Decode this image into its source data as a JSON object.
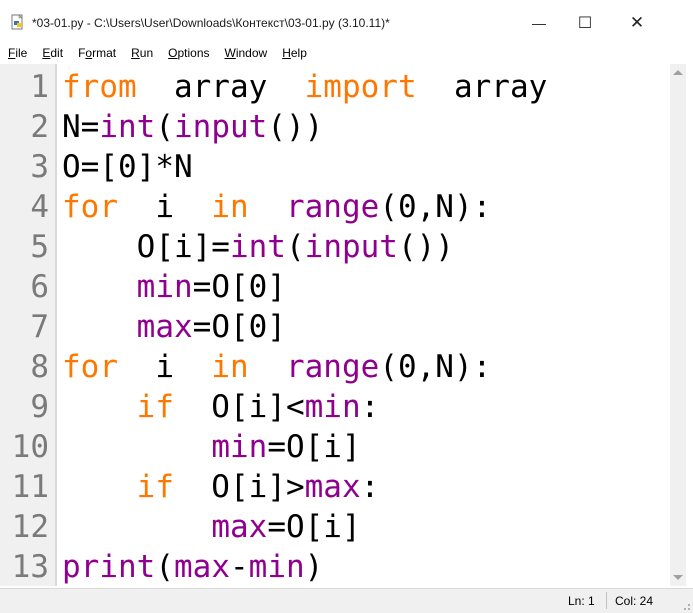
{
  "window": {
    "title": "*03-01.py - C:\\Users\\User\\Downloads\\Контекст\\03-01.py (3.10.11)*",
    "minimize_glyph": "—",
    "maximize_glyph": "☐",
    "close_glyph": "✕"
  },
  "menu": [
    {
      "pre": "",
      "ul": "F",
      "post": "ile"
    },
    {
      "pre": "",
      "ul": "E",
      "post": "dit"
    },
    {
      "pre": "F",
      "ul": "o",
      "post": "rmat"
    },
    {
      "pre": "",
      "ul": "R",
      "post": "un"
    },
    {
      "pre": "",
      "ul": "O",
      "post": "ptions"
    },
    {
      "pre": "",
      "ul": "W",
      "post": "indow"
    },
    {
      "pre": "",
      "ul": "H",
      "post": "elp"
    }
  ],
  "colors": {
    "keyword": "#ff7700",
    "builtin": "#900090",
    "text": "#000000",
    "line_number": "#7a7a7a"
  },
  "code": [
    {
      "n": "1",
      "t": [
        [
          "kw",
          "from"
        ],
        [
          "",
          "  array  "
        ],
        [
          "kw",
          "import"
        ],
        [
          "",
          "  array"
        ]
      ]
    },
    {
      "n": "2",
      "t": [
        [
          "",
          "N="
        ],
        [
          "bi",
          "int"
        ],
        [
          "",
          "("
        ],
        [
          "bi",
          "input"
        ],
        [
          "",
          "())"
        ]
      ]
    },
    {
      "n": "3",
      "t": [
        [
          "",
          "O=[0]*N"
        ]
      ]
    },
    {
      "n": "4",
      "t": [
        [
          "kw",
          "for"
        ],
        [
          "",
          "  i  "
        ],
        [
          "kw",
          "in"
        ],
        [
          "",
          "  "
        ],
        [
          "bi",
          "range"
        ],
        [
          "",
          "(0,N):"
        ]
      ]
    },
    {
      "n": "5",
      "t": [
        [
          "",
          "    O[i]="
        ],
        [
          "bi",
          "int"
        ],
        [
          "",
          "("
        ],
        [
          "bi",
          "input"
        ],
        [
          "",
          "())"
        ]
      ]
    },
    {
      "n": "6",
      "t": [
        [
          "",
          "    "
        ],
        [
          "bi",
          "min"
        ],
        [
          "",
          "=O[0]"
        ]
      ]
    },
    {
      "n": "7",
      "t": [
        [
          "",
          "    "
        ],
        [
          "bi",
          "max"
        ],
        [
          "",
          "=O[0]"
        ]
      ]
    },
    {
      "n": "8",
      "t": [
        [
          "kw",
          "for"
        ],
        [
          "",
          "  i  "
        ],
        [
          "kw",
          "in"
        ],
        [
          "",
          "  "
        ],
        [
          "bi",
          "range"
        ],
        [
          "",
          "(0,N):"
        ]
      ]
    },
    {
      "n": "9",
      "t": [
        [
          "",
          "    "
        ],
        [
          "kw",
          "if"
        ],
        [
          "",
          "  O[i]<"
        ],
        [
          "bi",
          "min"
        ],
        [
          "",
          ":"
        ]
      ]
    },
    {
      "n": "10",
      "t": [
        [
          "",
          "        "
        ],
        [
          "bi",
          "min"
        ],
        [
          "",
          "=O[i]"
        ]
      ]
    },
    {
      "n": "11",
      "t": [
        [
          "",
          "    "
        ],
        [
          "kw",
          "if"
        ],
        [
          "",
          "  O[i]>"
        ],
        [
          "bi",
          "max"
        ],
        [
          "",
          ":"
        ]
      ]
    },
    {
      "n": "12",
      "t": [
        [
          "",
          "        "
        ],
        [
          "bi",
          "max"
        ],
        [
          "",
          "=O[i]"
        ]
      ]
    },
    {
      "n": "13",
      "t": [
        [
          "bi",
          "print"
        ],
        [
          "",
          "("
        ],
        [
          "bi",
          "max"
        ],
        [
          "",
          "-"
        ],
        [
          "bi",
          "min"
        ],
        [
          "",
          ")"
        ]
      ]
    }
  ],
  "status": {
    "ln": "Ln: 1",
    "col": "Col: 24"
  }
}
